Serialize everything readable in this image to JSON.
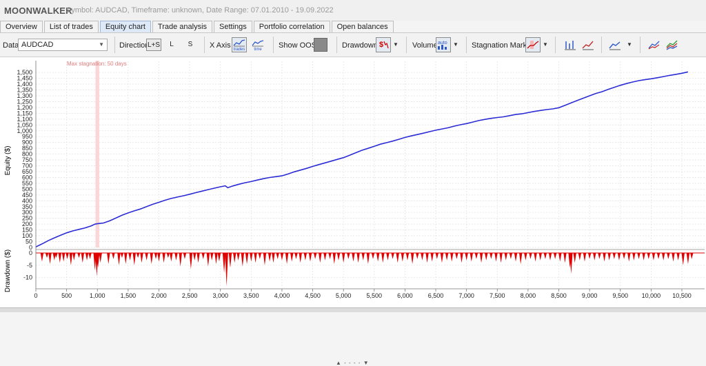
{
  "header": {
    "app_title": "MOONWALKER",
    "info": "Symbol: AUDCAD, Timeframe: unknown, Date Range: 07.01.2010 - 19.09.2022"
  },
  "tabs": [
    {
      "label": "Overview",
      "active": false
    },
    {
      "label": "List of trades",
      "active": false
    },
    {
      "label": "Equity chart",
      "active": true
    },
    {
      "label": "Trade analysis",
      "active": false
    },
    {
      "label": "Settings",
      "active": false
    },
    {
      "label": "Portfolio correlation",
      "active": false
    },
    {
      "label": "Open balances",
      "active": false
    }
  ],
  "toolbar": {
    "data_label": "Data",
    "data_value": "AUDCAD",
    "direction_label": "Direction",
    "direction_options": [
      "L+S",
      "L",
      "S"
    ],
    "direction_selected": "L+S",
    "xaxis_label": "X Axis",
    "xaxis_trades_caption": "trades",
    "xaxis_time_caption": "time",
    "show_oos_label": "Show OOS",
    "drawdown_label": "Drawdown",
    "volume_label": "Volume",
    "volume_caption": "auto",
    "stagnation_label": "Stagnation Marker"
  },
  "colors": {
    "equity_line": "#2b2bd6",
    "drawdown_fill": "#e00000",
    "stagnation_band": "#fbd6d6",
    "stagnation_text": "#e07a7a",
    "grid": "#e4e4e4"
  },
  "chart_data": {
    "type": "line",
    "stagnation_label": "Max stagnation: 50 days",
    "stagnation_range": [
      970,
      1030
    ],
    "equity": {
      "ylabel": "Equity ($)",
      "ylim": [
        0,
        1560
      ],
      "y_ticks": [
        0,
        50,
        100,
        150,
        200,
        250,
        300,
        350,
        400,
        450,
        500,
        550,
        600,
        650,
        700,
        750,
        800,
        850,
        900,
        950,
        1000,
        1050,
        1100,
        1150,
        1200,
        1250,
        1300,
        1350,
        1400,
        1450,
        1500
      ],
      "y_tick_labels": [
        "0",
        "50",
        "100",
        "150",
        "200",
        "250",
        "300",
        "350",
        "400",
        "450",
        "500",
        "550",
        "600",
        "650",
        "700",
        "750",
        "800",
        "850",
        "900",
        "950",
        "1,000",
        "1,050",
        "1,100",
        "1,150",
        "1,200",
        "1,250",
        "1,300",
        "1,350",
        "1,400",
        "1,450",
        "1,500"
      ],
      "x": [
        0,
        100,
        200,
        300,
        400,
        500,
        600,
        700,
        800,
        900,
        960,
        1000,
        1050,
        1100,
        1200,
        1300,
        1400,
        1500,
        1600,
        1700,
        1800,
        1900,
        2000,
        2100,
        2200,
        2300,
        2400,
        2500,
        2600,
        2700,
        2800,
        2900,
        3000,
        3080,
        3120,
        3200,
        3300,
        3400,
        3500,
        3600,
        3700,
        3800,
        3900,
        4000,
        4100,
        4200,
        4300,
        4400,
        4500,
        4600,
        4700,
        4800,
        4900,
        5000,
        5100,
        5200,
        5300,
        5400,
        5500,
        5600,
        5700,
        5800,
        5900,
        6000,
        6100,
        6200,
        6300,
        6400,
        6500,
        6600,
        6700,
        6800,
        6900,
        7000,
        7100,
        7200,
        7300,
        7400,
        7500,
        7600,
        7700,
        7800,
        7900,
        8000,
        8100,
        8200,
        8300,
        8400,
        8500,
        8600,
        8700,
        8800,
        8900,
        9000,
        9100,
        9200,
        9300,
        9400,
        9500,
        9600,
        9700,
        9800,
        9900,
        10000,
        10100,
        10200,
        10300,
        10400,
        10500,
        10600,
        10700,
        10800,
        10870
      ],
      "y": [
        5,
        30,
        58,
        82,
        104,
        125,
        142,
        155,
        168,
        185,
        200,
        203,
        206,
        210,
        228,
        252,
        276,
        296,
        314,
        330,
        350,
        370,
        387,
        405,
        420,
        432,
        443,
        456,
        470,
        483,
        496,
        508,
        520,
        528,
        512,
        527,
        542,
        555,
        565,
        578,
        590,
        600,
        607,
        614,
        630,
        648,
        663,
        678,
        695,
        710,
        725,
        740,
        755,
        770,
        790,
        812,
        833,
        850,
        867,
        885,
        898,
        912,
        927,
        943,
        956,
        968,
        980,
        993,
        1005,
        1016,
        1026,
        1040,
        1052,
        1062,
        1075,
        1088,
        1098,
        1107,
        1114,
        1120,
        1130,
        1140,
        1146,
        1156,
        1166,
        1174,
        1182,
        1188,
        1198,
        1218,
        1240,
        1260,
        1280,
        1300,
        1320,
        1335,
        1355,
        1372,
        1390,
        1405,
        1418,
        1430,
        1438,
        1446,
        1455,
        1465,
        1475,
        1484,
        1493,
        1505
      ]
    },
    "drawdown": {
      "ylabel": "Drawdown ($)",
      "ylim": [
        -14,
        0
      ],
      "y_ticks": [
        0,
        -5,
        -10
      ],
      "y_tick_labels": [
        "0",
        "-5",
        "-10"
      ],
      "x": [
        100,
        180,
        230,
        300,
        330,
        390,
        450,
        510,
        570,
        620,
        700,
        760,
        830,
        880,
        960,
        990,
        1010,
        1050,
        1180,
        1260,
        1350,
        1400,
        1460,
        1530,
        1600,
        1660,
        1720,
        1800,
        1880,
        1950,
        2000,
        2080,
        2150,
        2200,
        2280,
        2350,
        2420,
        2520,
        2580,
        2640,
        2720,
        2800,
        2860,
        2930,
        2980,
        3060,
        3100,
        3160,
        3230,
        3290,
        3360,
        3430,
        3500,
        3570,
        3640,
        3720,
        3800,
        3860,
        3930,
        4000,
        4080,
        4160,
        4230,
        4300,
        4380,
        4460,
        4540,
        4620,
        4700,
        4780,
        4850,
        4920,
        5000,
        5080,
        5160,
        5240,
        5320,
        5400,
        5480,
        5560,
        5640,
        5720,
        5800,
        5880,
        5960,
        6040,
        6120,
        6200,
        6280,
        6360,
        6440,
        6520,
        6600,
        6680,
        6760,
        6840,
        6920,
        7000,
        7080,
        7160,
        7240,
        7320,
        7400,
        7480,
        7560,
        7640,
        7720,
        7800,
        7880,
        7960,
        8040,
        8120,
        8200,
        8280,
        8360,
        8440,
        8520,
        8600,
        8680,
        8700,
        8760,
        8840,
        8920,
        9000,
        9080,
        9160,
        9240,
        9320,
        9400,
        9480,
        9560,
        9640,
        9720,
        9800,
        9880,
        9960,
        10040,
        10120,
        10200,
        10280,
        10360,
        10440,
        10520,
        10600,
        10660,
        10720,
        10800
      ],
      "y": [
        -3.5,
        -2,
        -4.5,
        -3,
        -2,
        -4,
        -3.5,
        -2.5,
        -5,
        -3,
        -2,
        -4,
        -3,
        -2.5,
        -7,
        -9.5,
        -6,
        -4,
        -4.5,
        -2.5,
        -5,
        -2,
        -4.5,
        -3,
        -5,
        -2,
        -4,
        -3,
        -4.5,
        -2.5,
        -3.5,
        -4,
        -2,
        -3.5,
        -3,
        -5.5,
        -2.5,
        -6.5,
        -3,
        -4,
        -2.5,
        -5.5,
        -3,
        -4.5,
        -3.5,
        -8,
        -13.5,
        -6,
        -4,
        -3,
        -5.5,
        -4.5,
        -3.5,
        -4,
        -2.5,
        -5,
        -3.5,
        -4,
        -2.5,
        -3,
        -4.5,
        -3.5,
        -2.5,
        -4,
        -3,
        -3.5,
        -2.5,
        -4,
        -3,
        -2.5,
        -4.5,
        -3,
        -4,
        -2.5,
        -3.5,
        -4,
        -3,
        -4.5,
        -2.5,
        -3.5,
        -4,
        -3,
        -2.5,
        -4,
        -3.5,
        -3,
        -4.5,
        -2.5,
        -3,
        -4,
        -3.5,
        -2.5,
        -4,
        -3,
        -3.5,
        -2.5,
        -4,
        -3,
        -3.5,
        -2.5,
        -4,
        -3,
        -2.5,
        -3.5,
        -4,
        -3,
        -2.5,
        -3.5,
        -4.5,
        -3,
        -2.5,
        -3.5,
        -3,
        -2.5,
        -3,
        -2.5,
        -3.5,
        -4,
        -6,
        -8.5,
        -4,
        -3,
        -3.5,
        -2.5,
        -3,
        -2.5,
        -3.5,
        -3,
        -2.5,
        -3,
        -2.5,
        -3.5,
        -3,
        -2.5,
        -3,
        -2.5,
        -3,
        -2.5,
        -3,
        -2.5,
        -3.5,
        -3,
        -5,
        -4.5,
        -2.5
      ]
    },
    "x_axis": {
      "xlim": [
        0,
        10870
      ],
      "ticks": [
        0,
        500,
        1000,
        1500,
        2000,
        2500,
        3000,
        3500,
        4000,
        4500,
        5000,
        5500,
        6000,
        6500,
        7000,
        7500,
        8000,
        8500,
        9000,
        9500,
        10000,
        10500
      ],
      "tick_labels": [
        "0",
        "500",
        "1,000",
        "1,500",
        "2,000",
        "2,500",
        "3,000",
        "3,500",
        "4,000",
        "4,500",
        "5,000",
        "5,500",
        "6,000",
        "6,500",
        "7,000",
        "7,500",
        "8,000",
        "8,500",
        "9,000",
        "9,500",
        "10,000",
        "10,500"
      ],
      "grid": true
    }
  }
}
